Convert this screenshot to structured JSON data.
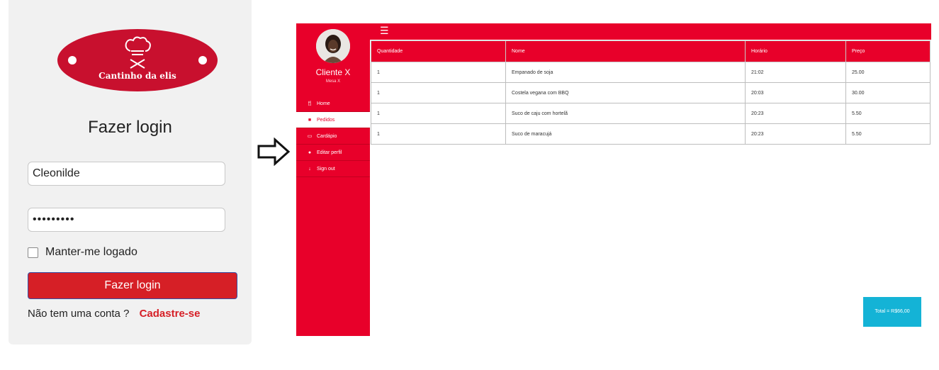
{
  "login": {
    "logo_text": "Cantinho da elis",
    "title": "Fazer login",
    "username_value": "Cleonilde",
    "password_value": "•••••••••",
    "remember_label": "Manter-me logado",
    "submit_label": "Fazer login",
    "no_account_text": "Não tem uma conta ?",
    "signup_link": "Cadastre-se"
  },
  "app": {
    "client_name": "Cliente X",
    "table_label": "Mesa X",
    "nav": [
      {
        "label": "Home",
        "icon": "utensils-icon"
      },
      {
        "label": "Pedidos",
        "icon": "orders-icon"
      },
      {
        "label": "Cardápio",
        "icon": "monitor-icon"
      },
      {
        "label": "Editar perfil",
        "icon": "user-icon"
      },
      {
        "label": "Sign out",
        "icon": "arrow-down-icon"
      }
    ],
    "active_nav": "Pedidos",
    "table": {
      "headers": [
        "Quantidade",
        "Nome",
        "Horário",
        "Preço"
      ],
      "rows": [
        [
          "1",
          "Empanado de soja",
          "21:02",
          "25.00"
        ],
        [
          "1",
          "Costela vegana com BBQ",
          "20:03",
          "30.00"
        ],
        [
          "1",
          "Suco de caju com hortelã",
          "20:23",
          "5.50"
        ],
        [
          "1",
          "Suco de maracujá",
          "20:23",
          "5.50"
        ]
      ]
    },
    "total_label": "Total = R$66,00"
  },
  "colors": {
    "brand_red": "#e8002a",
    "login_red": "#d61f26",
    "total_button": "#14b3d6"
  }
}
